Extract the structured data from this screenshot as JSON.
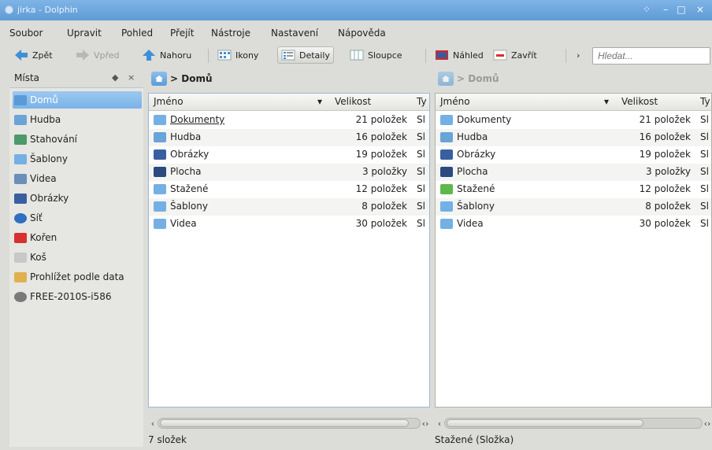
{
  "window": {
    "title": "jirka - Dolphin"
  },
  "menu": [
    {
      "label": "Soubor"
    },
    {
      "label": "Upravit"
    },
    {
      "label": "Pohled"
    },
    {
      "label": "Přejít"
    },
    {
      "label": "Nástroje"
    },
    {
      "label": "Nastavení"
    },
    {
      "label": "Nápověda"
    }
  ],
  "toolbar": {
    "back": "Zpět",
    "forward": "Vpřed",
    "up": "Nahoru",
    "icons": "Ikony",
    "details": "Detaily",
    "columns": "Sloupce",
    "preview": "Náhled",
    "close": "Zavřít",
    "search_arrow": "›",
    "search_placeholder": "Hledat..."
  },
  "places": {
    "title": "Místa",
    "items": [
      {
        "label": "Domů",
        "icon": "home-icon",
        "color": "#5a9ad6"
      },
      {
        "label": "Hudba",
        "icon": "music-folder-icon",
        "color": "#6aa4d8"
      },
      {
        "label": "Stahování",
        "icon": "download-folder-icon",
        "color": "#4a9a6a"
      },
      {
        "label": "Šablony",
        "icon": "folder-icon",
        "color": "#74b0e4"
      },
      {
        "label": "Videa",
        "icon": "video-folder-icon",
        "color": "#6a8fb8"
      },
      {
        "label": "Obrázky",
        "icon": "pictures-folder-icon",
        "color": "#3a5fa0"
      },
      {
        "label": "Síť",
        "icon": "network-icon",
        "color": "#2f6fc0"
      },
      {
        "label": "Kořen",
        "icon": "root-icon",
        "color": "#d83030"
      },
      {
        "label": "Koš",
        "icon": "trash-icon",
        "color": "#c8c8c8"
      },
      {
        "label": "Prohlížet podle data",
        "icon": "calendar-icon",
        "color": "#e0b050"
      },
      {
        "label": "FREE-2010S-i586",
        "icon": "disc-icon",
        "color": "#7a7a7a"
      }
    ]
  },
  "left_pane": {
    "path": "Domů",
    "columns": {
      "name": "Jméno",
      "size": "Velikost",
      "type": "Ty"
    },
    "rows": [
      {
        "name": "Dokumenty",
        "size": "21 položek",
        "type": "Sl"
      },
      {
        "name": "Hudba",
        "size": "16 položek",
        "type": "Sl"
      },
      {
        "name": "Obrázky",
        "size": "19 položek",
        "type": "Sl"
      },
      {
        "name": "Plocha",
        "size": "3 položky",
        "type": "Sl"
      },
      {
        "name": "Stažené",
        "size": "12 položek",
        "type": "Sl"
      },
      {
        "name": "Šablony",
        "size": "8 položek",
        "type": "Sl"
      },
      {
        "name": "Videa",
        "size": "30 položek",
        "type": "Sl"
      }
    ],
    "status": "7 složek"
  },
  "right_pane": {
    "path": "Domů",
    "columns": {
      "name": "Jméno",
      "size": "Velikost",
      "type": "Ty"
    },
    "rows": [
      {
        "name": "Dokumenty",
        "size": "21 položek",
        "type": "Sl"
      },
      {
        "name": "Hudba",
        "size": "16 položek",
        "type": "Sl"
      },
      {
        "name": "Obrázky",
        "size": "19 položek",
        "type": "Sl"
      },
      {
        "name": "Plocha",
        "size": "3 položky",
        "type": "Sl"
      },
      {
        "name": "Stažené",
        "size": "12 položek",
        "type": "Sl"
      },
      {
        "name": "Šablony",
        "size": "8 položek",
        "type": "Sl"
      },
      {
        "name": "Videa",
        "size": "30 položek",
        "type": "Sl"
      }
    ],
    "status": "Stažené (Složka)"
  },
  "row_icons": [
    {
      "icon": "documents-folder-icon",
      "color": "#74b0e4"
    },
    {
      "icon": "music-folder-icon",
      "color": "#6aa4d8"
    },
    {
      "icon": "pictures-folder-icon",
      "color": "#3a5fa0"
    },
    {
      "icon": "desktop-folder-icon",
      "color": "#2a4a80"
    },
    {
      "icon": "folder-icon",
      "color": "#74b0e4"
    },
    {
      "icon": "templates-folder-icon",
      "color": "#74b0e4"
    },
    {
      "icon": "video-folder-icon",
      "color": "#74b0e4"
    }
  ]
}
